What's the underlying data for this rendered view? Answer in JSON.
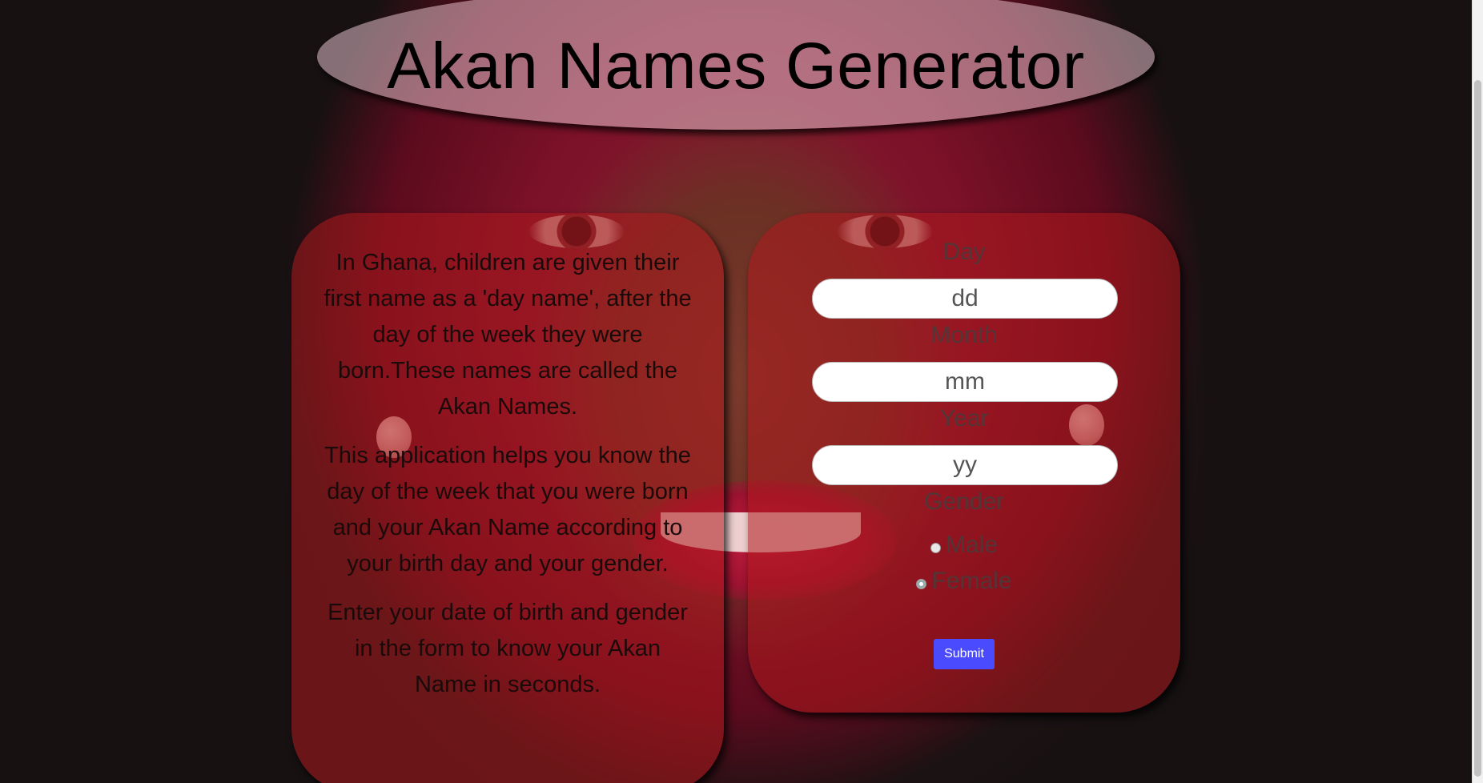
{
  "header": {
    "title": "Akan Names Generator"
  },
  "info": {
    "paragraphs": [
      "In Ghana, children are given their first name as a 'day name', after the day of the week they were born.These names are called the Akan Names.",
      "This application helps you know the day of the week that you were born and your Akan Name according to your birth day and your gender.",
      "Enter your date of birth and gender in the form to know your Akan Name in seconds."
    ]
  },
  "form": {
    "day": {
      "label": "Day",
      "placeholder": "dd",
      "value": ""
    },
    "month": {
      "label": "Month",
      "placeholder": "mm",
      "value": ""
    },
    "year": {
      "label": "Year",
      "placeholder": "yy",
      "value": ""
    },
    "gender": {
      "label": "Gender",
      "options": [
        {
          "label": "Male",
          "selected": false
        },
        {
          "label": "Female",
          "selected": false
        }
      ]
    },
    "submit_label": "Submit"
  },
  "colors": {
    "submit_bg": "#4a4aff",
    "panel_tint": "#af191e",
    "header_tint": "#e1bec8"
  }
}
